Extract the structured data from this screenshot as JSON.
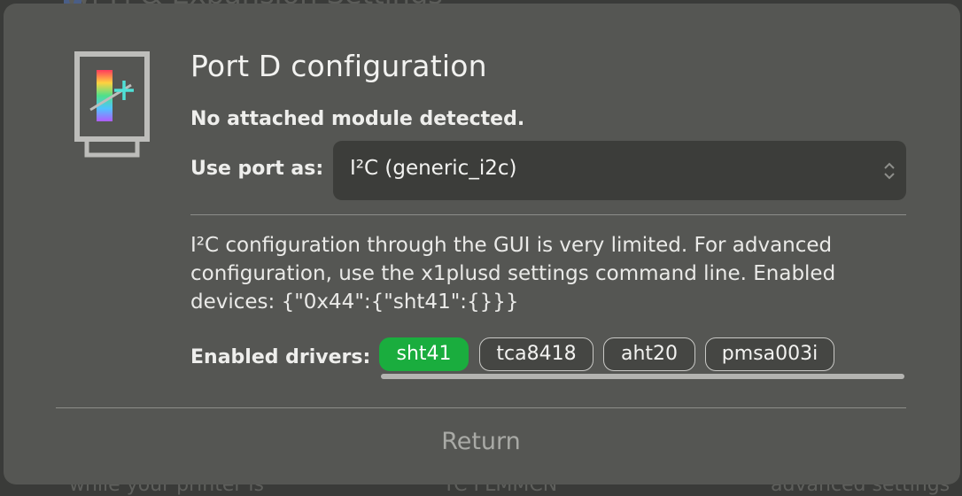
{
  "background": {
    "top_text": "Wi-Fi & Expansion Settings",
    "bottom_texts": [
      "while your printer is",
      "TC FLMMCN",
      "advanced settings"
    ]
  },
  "dialog": {
    "logo_icon": "x1plus-logo-icon",
    "title": "Port D configuration",
    "status": "No attached module detected.",
    "use_port_label": "Use port as:",
    "port_select": {
      "value": "I²C (generic_i2c)",
      "icon": "updown-chevron-icon"
    },
    "description": "I²C configuration through the GUI is very limited.  For advanced configuration, use the x1plusd settings command line.  Enabled devices: {\"0x44\":{\"sht41\":{}}}",
    "drivers_label": "Enabled drivers:",
    "drivers": [
      {
        "label": "sht41",
        "enabled": true
      },
      {
        "label": "tca8418",
        "enabled": false
      },
      {
        "label": "aht20",
        "enabled": false
      },
      {
        "label": "pmsa003i",
        "enabled": false
      }
    ],
    "return_label": "Return"
  },
  "colors": {
    "dialog_bg": "#555653",
    "select_bg": "#3c3d3a",
    "accent_enabled": "#1aad3e",
    "divider": "#8c8d89"
  }
}
